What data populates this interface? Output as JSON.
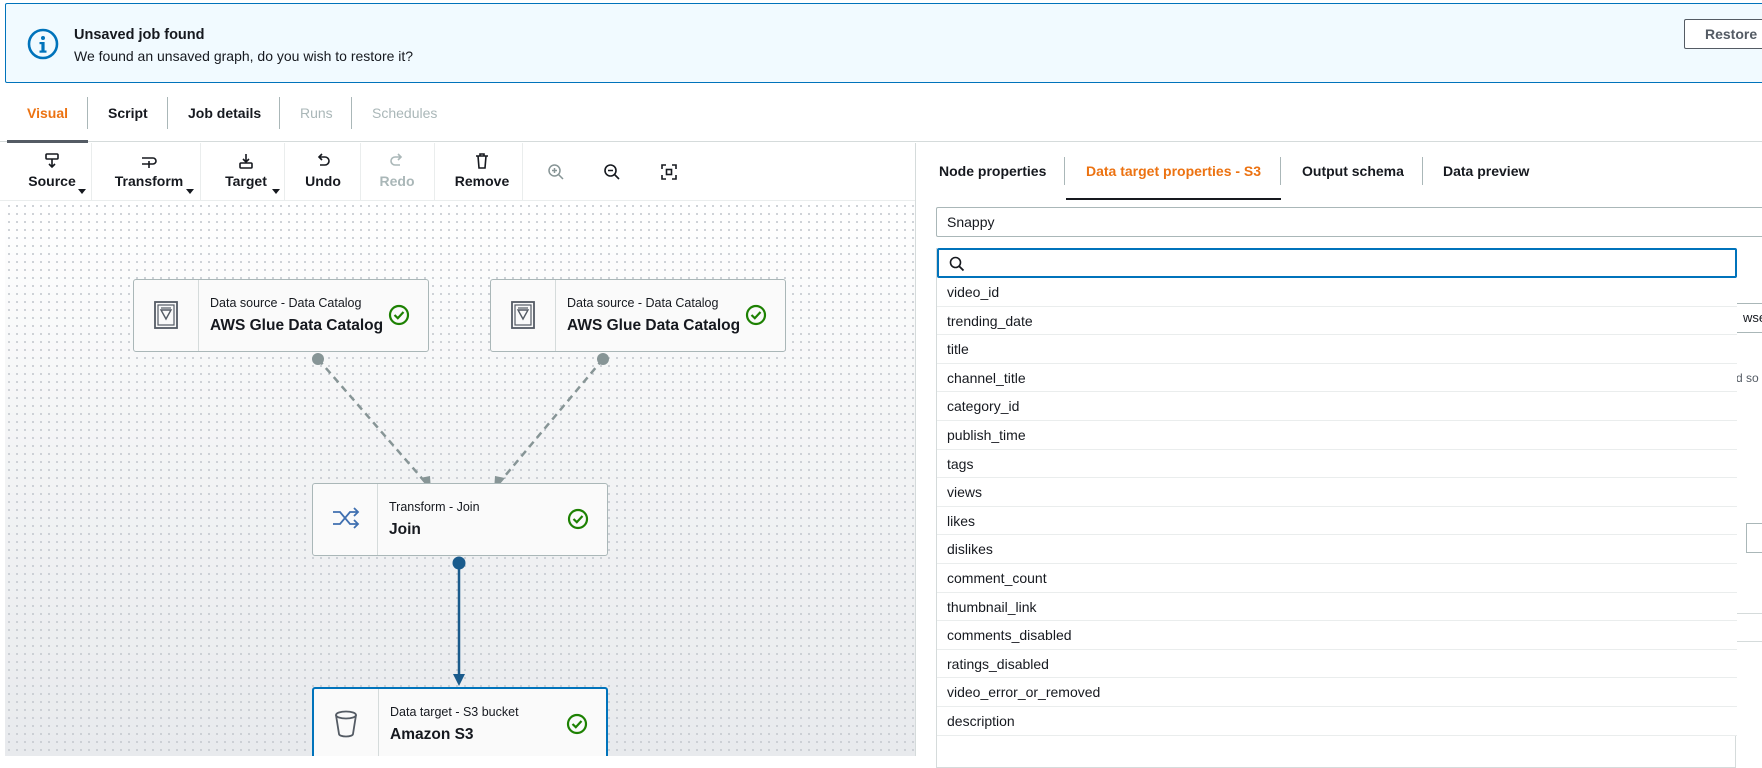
{
  "banner": {
    "title": "Unsaved job found",
    "message": "We found an unsaved graph, do you wish to restore it?",
    "restore_label": "Restore",
    "icon": "info-icon",
    "accent_color": "#0073bb",
    "background_color": "#f1faff"
  },
  "tabs": [
    {
      "label": "Visual",
      "state": "active"
    },
    {
      "label": "Script",
      "state": "enabled"
    },
    {
      "label": "Job details",
      "state": "enabled"
    },
    {
      "label": "Runs",
      "state": "disabled"
    },
    {
      "label": "Schedules",
      "state": "disabled"
    }
  ],
  "toolbar": {
    "source_label": "Source",
    "transform_label": "Transform",
    "target_label": "Target",
    "undo_label": "Undo",
    "redo_label": "Redo",
    "remove_label": "Remove",
    "zoom_in_icon": "zoom-in-icon",
    "zoom_out_icon": "zoom-out-icon",
    "fit_icon": "fit-to-screen-icon"
  },
  "nodes": [
    {
      "id": "src1",
      "type": "Data source - Data Catalog",
      "name": "AWS Glue Data Catalog",
      "icon": "data-catalog-icon",
      "status": "check-circle-icon"
    },
    {
      "id": "src2",
      "type": "Data source - Data Catalog",
      "name": "AWS Glue Data Catalog",
      "icon": "data-catalog-icon",
      "status": "check-circle-icon"
    },
    {
      "id": "join",
      "type": "Transform - Join",
      "name": "Join",
      "icon": "shuffle-icon",
      "status": "check-circle-icon"
    },
    {
      "id": "tgt",
      "type": "Data target - S3 bucket",
      "name": "Amazon S3",
      "icon": "bucket-icon",
      "status": "check-circle-icon"
    }
  ],
  "panel": {
    "tabs": [
      {
        "label": "Node properties",
        "state": "enabled"
      },
      {
        "label": "Data target properties - S3",
        "state": "active"
      },
      {
        "label": "Output schema",
        "state": "enabled"
      },
      {
        "label": "Data preview",
        "state": "enabled"
      }
    ],
    "compression_value": "Snappy",
    "search_placeholder": "",
    "background_browse_fragment": "wse",
    "background_text_fragment": "d so",
    "options": [
      "video_id",
      "trending_date",
      "title",
      "channel_title",
      "category_id",
      "publish_time",
      "tags",
      "views",
      "likes",
      "dislikes",
      "comment_count",
      "thumbnail_link",
      "comments_disabled",
      "ratings_disabled",
      "video_error_or_removed",
      "description"
    ]
  },
  "colors": {
    "accent_orange": "#ec7211",
    "link_blue": "#0073bb",
    "success_green": "#1d8102",
    "edge_gray": "#879596"
  }
}
